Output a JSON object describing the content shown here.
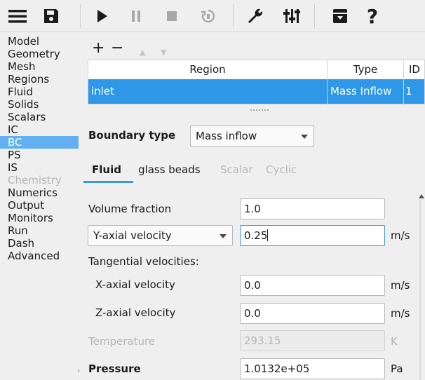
{
  "toolbar": {
    "icons": [
      "menu-icon",
      "save-icon",
      "play-icon",
      "pause-icon",
      "stop-icon",
      "reset-icon",
      "wrench-icon",
      "sliders-icon",
      "archive-icon",
      "help-icon"
    ],
    "help_glyph": "?"
  },
  "sidebar": {
    "items": [
      {
        "label": "Model",
        "state": "normal"
      },
      {
        "label": "Geometry",
        "state": "normal"
      },
      {
        "label": "Mesh",
        "state": "normal"
      },
      {
        "label": "Regions",
        "state": "normal"
      },
      {
        "label": "Fluid",
        "state": "normal"
      },
      {
        "label": "Solids",
        "state": "normal"
      },
      {
        "label": "Scalars",
        "state": "normal"
      },
      {
        "label": "IC",
        "state": "normal"
      },
      {
        "label": "BC",
        "state": "selected"
      },
      {
        "label": "PS",
        "state": "normal"
      },
      {
        "label": "IS",
        "state": "normal"
      },
      {
        "label": "Chemistry",
        "state": "disabled"
      },
      {
        "label": "Numerics",
        "state": "normal"
      },
      {
        "label": "Output",
        "state": "normal"
      },
      {
        "label": "Monitors",
        "state": "normal"
      },
      {
        "label": "Run",
        "state": "normal"
      },
      {
        "label": "Dash",
        "state": "normal"
      },
      {
        "label": "Advanced",
        "state": "normal"
      }
    ],
    "scroll_glyph": "‹"
  },
  "bc_tools": {
    "add": "+",
    "remove": "−",
    "up": "▲",
    "down": "▼"
  },
  "table": {
    "columns": [
      "Region",
      "Type",
      "ID"
    ],
    "rows": [
      {
        "region": "inlet",
        "type": "Mass Inflow",
        "id": "1"
      }
    ]
  },
  "splitter_glyph": "......",
  "boundary_type": {
    "label": "Boundary type",
    "value": "Mass inflow"
  },
  "tabs": [
    {
      "label": "Fluid",
      "state": "active"
    },
    {
      "label": "glass beads",
      "state": "normal"
    },
    {
      "label": "Scalar",
      "state": "disabled"
    },
    {
      "label": "Cyclic",
      "state": "disabled"
    }
  ],
  "form": {
    "volume_fraction": {
      "label": "Volume fraction",
      "value": "1.0"
    },
    "axial_velocity": {
      "select_value": "Y-axial velocity",
      "value": "0.25",
      "unit": "m/s"
    },
    "tangential_label": "Tangential velocities:",
    "x_axial_velocity": {
      "label": "X-axial velocity",
      "value": "0.0",
      "unit": "m/s"
    },
    "z_axial_velocity": {
      "label": "Z-axial velocity",
      "value": "0.0",
      "unit": "m/s"
    },
    "temperature": {
      "label": "Temperature",
      "value": "293.15",
      "unit": "K",
      "disabled": true
    },
    "pressure": {
      "label": "Pressure",
      "value": "1.0132e+05",
      "unit": "Pa"
    }
  },
  "colors": {
    "accent": "#2f97e8",
    "sidebar_selected": "#62b0f2",
    "disabled_text": "#b6b6b6"
  }
}
